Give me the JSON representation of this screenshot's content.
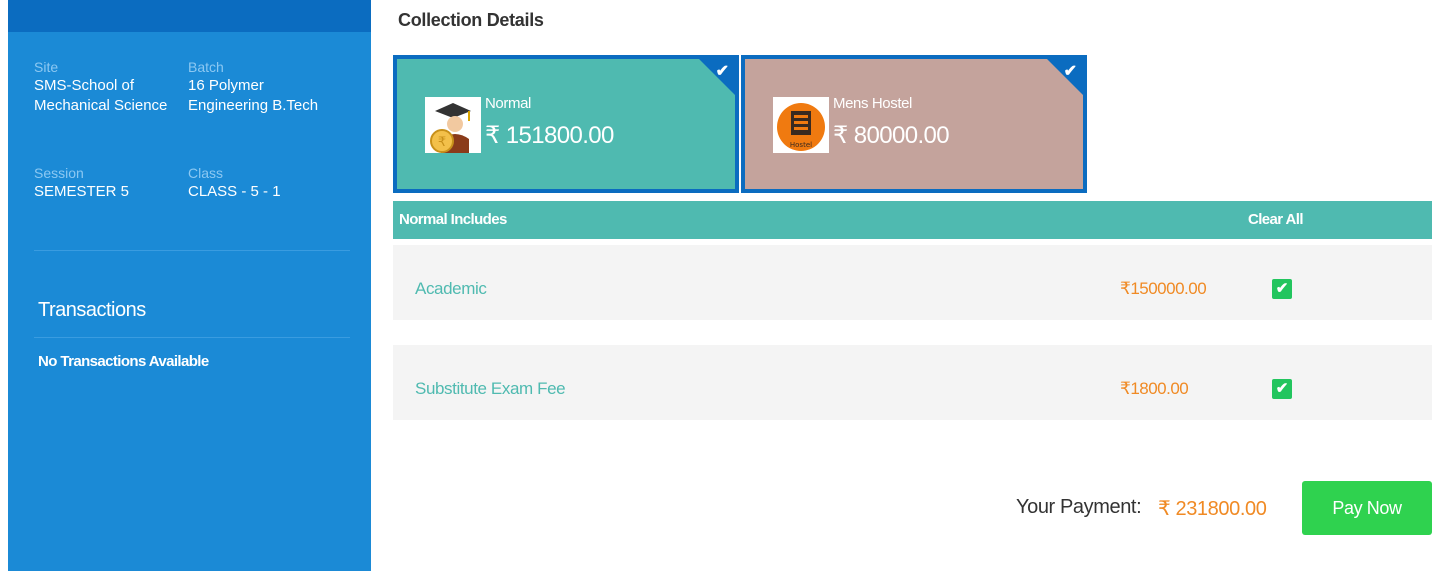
{
  "sidebar": {
    "site": {
      "label": "Site",
      "value_line1": "SMS-School of",
      "value_line2": "Mechanical Science"
    },
    "batch": {
      "label": "Batch",
      "value_line1": "16 Polymer",
      "value_line2": "Engineering B.Tech"
    },
    "session": {
      "label": "Session",
      "value": "SEMESTER 5"
    },
    "class": {
      "label": "Class",
      "value": "CLASS - 5 - 1"
    },
    "transactions_title": "Transactions",
    "transactions_empty": "No Transactions Available"
  },
  "main": {
    "section_title": "Collection Details",
    "cards": [
      {
        "name": "Normal",
        "amount": "₹ 151800.00",
        "icon": "graduate-icon",
        "selected": true,
        "color": "#4fbab0"
      },
      {
        "name": "Mens Hostel",
        "amount": "₹ 80000.00",
        "icon": "hostel-icon",
        "icon_text": "Hostel",
        "selected": true,
        "color": "#c4a39c"
      }
    ],
    "includes_title": "Normal Includes",
    "clear_all": "Clear All",
    "fees": [
      {
        "name": "Academic",
        "amount": "₹150000.00",
        "checked": true
      },
      {
        "name": "Substitute Exam Fee",
        "amount": "₹1800.00",
        "checked": true
      }
    ],
    "payment_label": "Your Payment:",
    "payment_amount": "₹ 231800.00",
    "pay_button": "Pay Now"
  },
  "colors": {
    "sidebar": "#1b8ad6",
    "accent_teal": "#4fbab0",
    "amount_orange": "#f08a24",
    "pay_green": "#2fd24f",
    "card_border": "#0b6cc0"
  }
}
